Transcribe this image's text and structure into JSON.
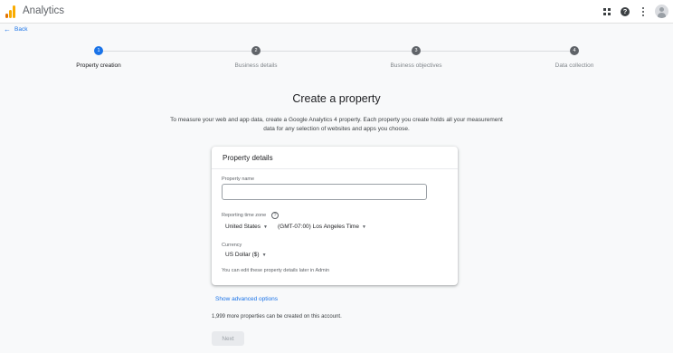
{
  "app": {
    "title": "Analytics"
  },
  "header": {
    "icons": [
      "apps-icon",
      "help-icon",
      "more-vert-icon",
      "avatar"
    ],
    "help_glyph": "?"
  },
  "nav": {
    "back_label": "Back",
    "back_arrow": "←"
  },
  "stepper": {
    "steps": [
      {
        "number": "1",
        "label": "Property creation",
        "state": "active"
      },
      {
        "number": "2",
        "label": "Business details",
        "state": "inactive"
      },
      {
        "number": "3",
        "label": "Business objectives",
        "state": "inactive"
      },
      {
        "number": "4",
        "label": "Data collection",
        "state": "inactive"
      }
    ]
  },
  "main": {
    "title": "Create a property",
    "description": "To measure your web and app data, create a Google Analytics 4 property. Each property you create holds all your measurement data for any selection of websites and apps you choose."
  },
  "card": {
    "title": "Property details",
    "property_name_label": "Property name",
    "property_name_value": "",
    "timezone_label": "Reporting time zone",
    "info_glyph": "?",
    "country_value": "United States",
    "timezone_value": "(GMT-07:00) Los Angeles Time",
    "currency_label": "Currency",
    "currency_value": "US Dollar ($)",
    "caret": "▼",
    "edit_hint": "You can edit these property details later in Admin"
  },
  "footer": {
    "advanced_link": "Show advanced options",
    "quota_text": "1,999 more properties can be created on this account.",
    "next_label": "Next"
  },
  "colors": {
    "accent": "#1a73e8",
    "step_active": "#1a73e8",
    "step_inactive": "#5f6368",
    "logo_bars": [
      "#e37400",
      "#f9ab00",
      "#f9ab00"
    ]
  }
}
